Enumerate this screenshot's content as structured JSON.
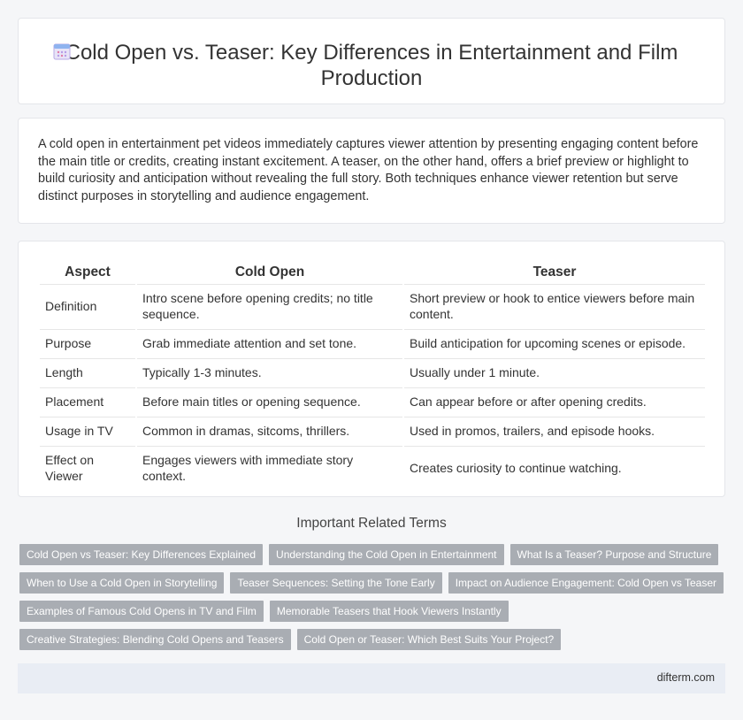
{
  "header": {
    "title": "Cold Open vs. Teaser: Key Differences in Entertainment and Film Production",
    "logo_icon": "calendar-icon"
  },
  "intro": {
    "text": "A cold open in entertainment pet videos immediately captures viewer attention by presenting engaging content before the main title or credits, creating instant excitement. A teaser, on the other hand, offers a brief preview or highlight to build curiosity and anticipation without revealing the full story. Both techniques enhance viewer retention but serve distinct purposes in storytelling and audience engagement."
  },
  "table": {
    "headers": [
      "Aspect",
      "Cold Open",
      "Teaser"
    ],
    "rows": [
      [
        "Definition",
        "Intro scene before opening credits; no title sequence.",
        "Short preview or hook to entice viewers before main content."
      ],
      [
        "Purpose",
        "Grab immediate attention and set tone.",
        "Build anticipation for upcoming scenes or episode."
      ],
      [
        "Length",
        "Typically 1-3 minutes.",
        "Usually under 1 minute."
      ],
      [
        "Placement",
        "Before main titles or opening sequence.",
        "Can appear before or after opening credits."
      ],
      [
        "Usage in TV",
        "Common in dramas, sitcoms, thrillers.",
        "Used in promos, trailers, and episode hooks."
      ],
      [
        "Effect on Viewer",
        "Engages viewers with immediate story context.",
        "Creates curiosity to continue watching."
      ]
    ]
  },
  "related": {
    "title": "Important Related Terms",
    "tags": [
      "Cold Open vs Teaser: Key Differences Explained",
      "Understanding the Cold Open in Entertainment",
      "What Is a Teaser? Purpose and Structure",
      "When to Use a Cold Open in Storytelling",
      "Teaser Sequences: Setting the Tone Early",
      "Impact on Audience Engagement: Cold Open vs Teaser",
      "Examples of Famous Cold Opens in TV and Film",
      "Memorable Teasers that Hook Viewers Instantly",
      "Creative Strategies: Blending Cold Opens and Teasers",
      "Cold Open or Teaser: Which Best Suits Your Project?"
    ]
  },
  "footer": {
    "site": "difterm.com"
  },
  "colors": {
    "tag_bg": "#a9adb3",
    "footer_bg": "#e9edf4",
    "page_bg": "#f5f6f8"
  }
}
